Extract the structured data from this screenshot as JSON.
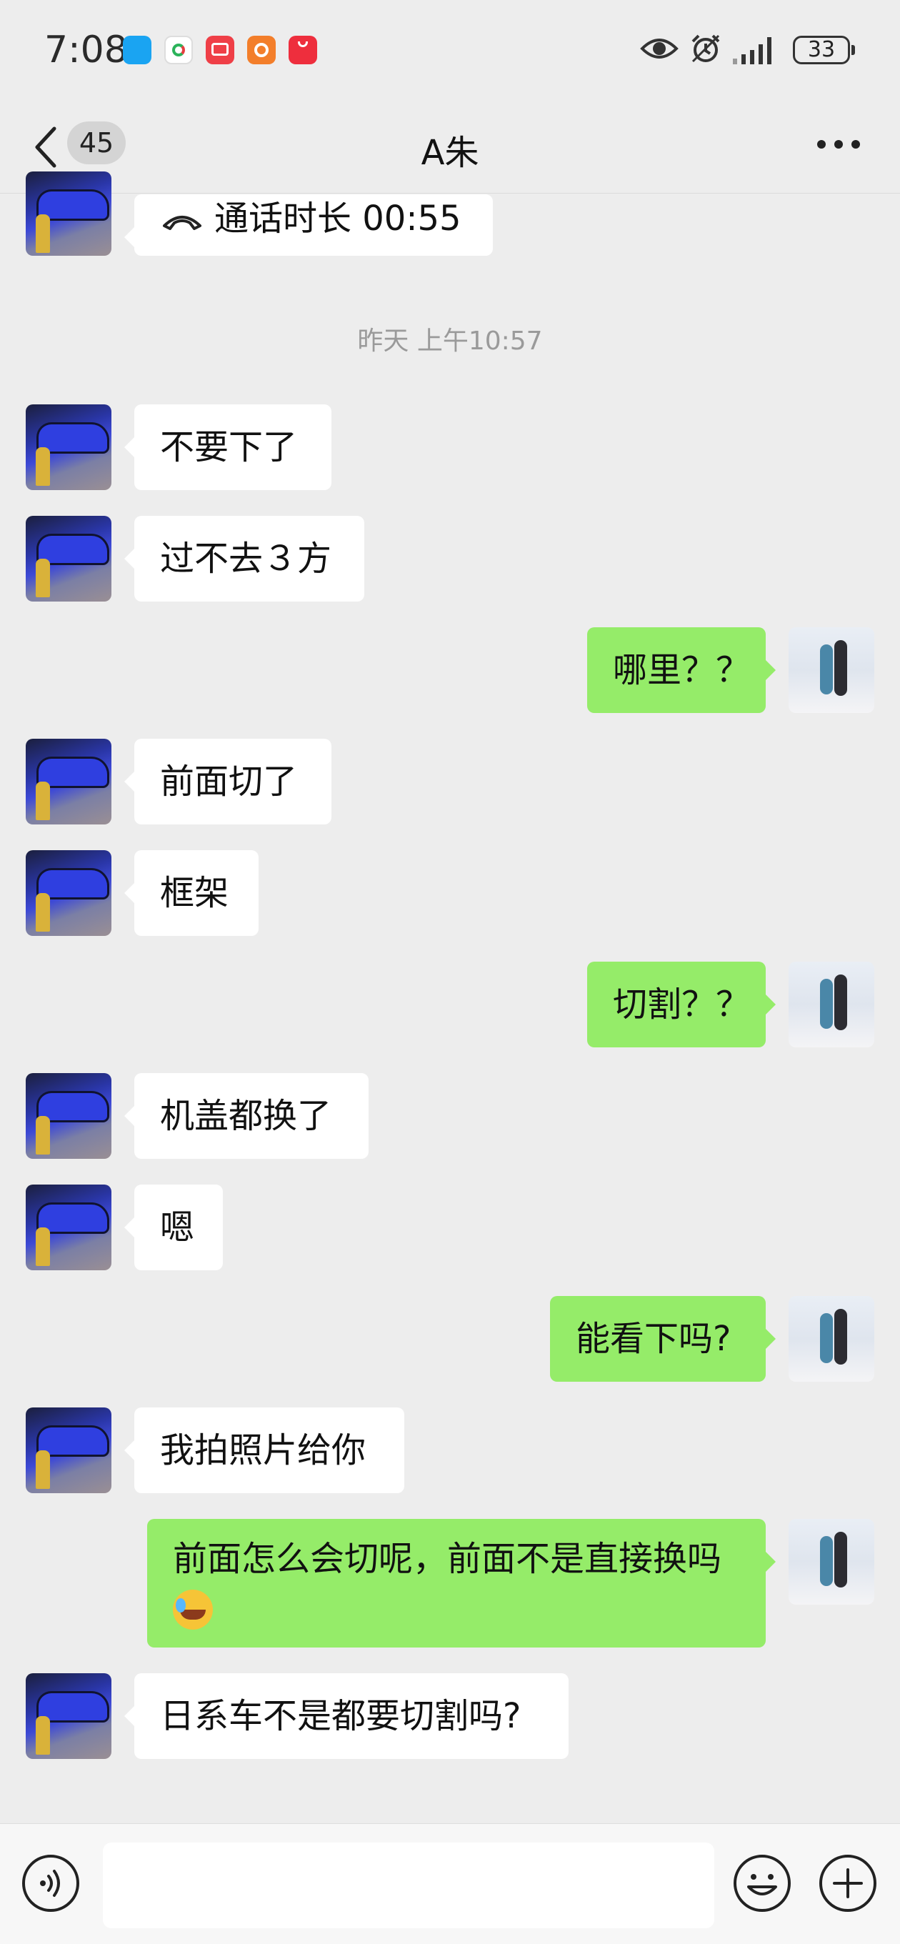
{
  "status_bar": {
    "time": "7:08",
    "battery": "33",
    "notification_icons": [
      "messages-icon",
      "mobile-app-icon",
      "email-icon",
      "home-app-icon",
      "appgallery-icon"
    ],
    "status_icons": [
      "eye-comfort-icon",
      "alarm-icon",
      "signal-icon",
      "battery-icon"
    ]
  },
  "header": {
    "unread_count": "45",
    "contact_name": "A朱"
  },
  "chat": {
    "call_record": "通话时长 00:55",
    "timestamp": "昨天 上午10:57",
    "messages": [
      {
        "from": "them",
        "text": "不要下了"
      },
      {
        "from": "them",
        "text": "过不去３方"
      },
      {
        "from": "me",
        "text": "哪里？？"
      },
      {
        "from": "them",
        "text": "前面切了"
      },
      {
        "from": "them",
        "text": "框架"
      },
      {
        "from": "me",
        "text": "切割？？"
      },
      {
        "from": "them",
        "text": "机盖都换了"
      },
      {
        "from": "them",
        "text": "嗯"
      },
      {
        "from": "me",
        "text": "能看下吗?"
      },
      {
        "from": "them",
        "text": "我拍照片给你"
      },
      {
        "from": "me",
        "text": "前面怎么会切呢，前面不是直接换吗"
      },
      {
        "from": "them",
        "text": "日系车不是都要切割吗?"
      }
    ]
  },
  "input_bar": {
    "value": "",
    "icons": [
      "voice-icon",
      "emoji-icon",
      "plus-icon"
    ]
  },
  "colors": {
    "background": "#ededed",
    "outgoing_bubble": "#95ec69",
    "incoming_bubble": "#ffffff"
  }
}
